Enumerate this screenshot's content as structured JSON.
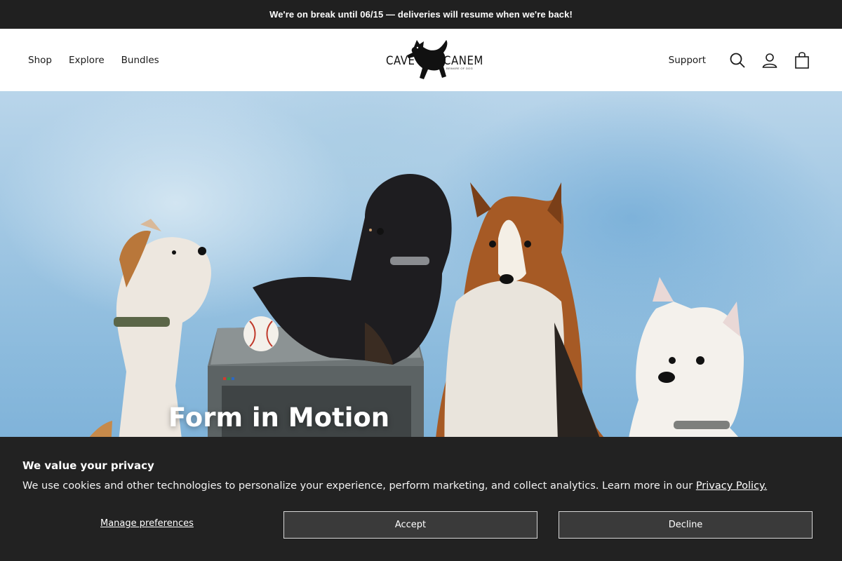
{
  "announcement": {
    "text": "We're on break until 06/15 — deliveries will resume when we're back!"
  },
  "header": {
    "nav": [
      "Shop",
      "Explore",
      "Bundles"
    ],
    "logo": {
      "word_left": "CAVE",
      "word_right": "CANEM",
      "tagline": "BEWARE OF DOG"
    },
    "support_label": "Support",
    "icons": [
      "search-icon",
      "account-icon",
      "cart-icon"
    ]
  },
  "hero": {
    "title": "Form in Motion"
  },
  "cookie_banner": {
    "title": "We value your privacy",
    "body": "We use cookies and other technologies to personalize your experience, perform marketing, and collect analytics. Learn more in our ",
    "policy_link": "Privacy Policy.",
    "manage_label": "Manage preferences",
    "accept_label": "Accept",
    "decline_label": "Decline"
  },
  "colors": {
    "announcement_bg": "#202020",
    "banner_bg": "#222222",
    "button_bg": "#3a3a3a"
  }
}
